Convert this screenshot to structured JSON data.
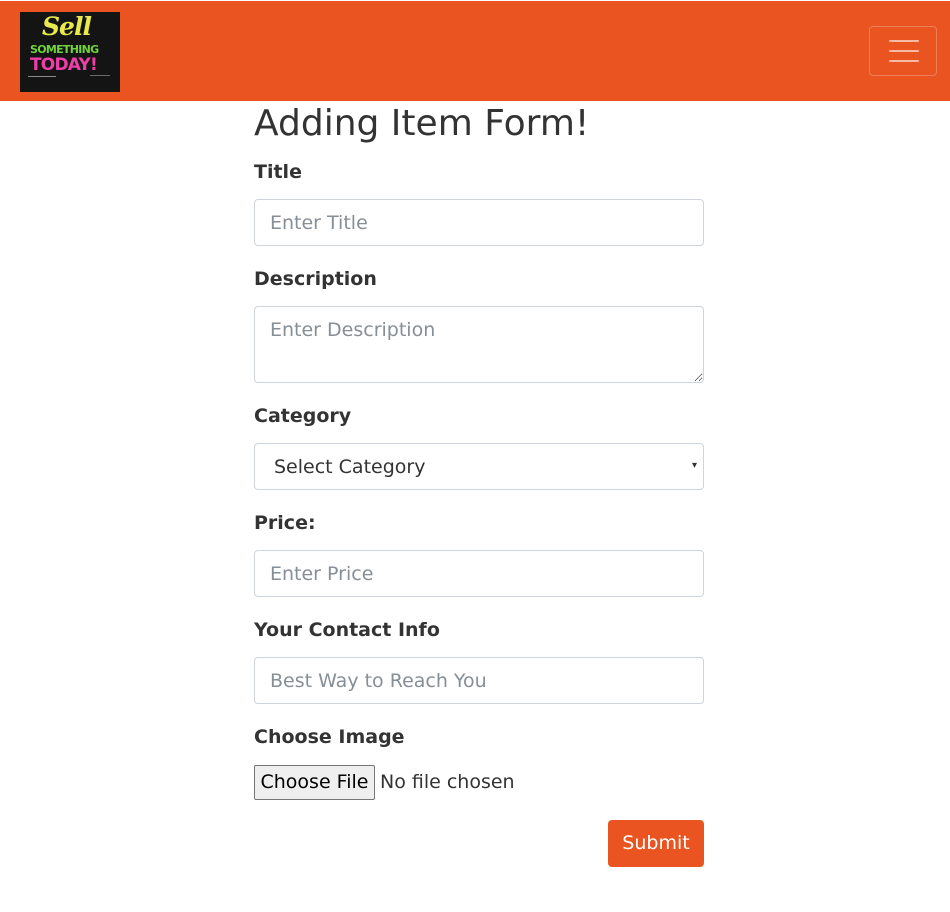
{
  "navbar": {
    "logo": {
      "line1": "Sell",
      "line2": "SOMETHING",
      "line3": "TODAY!"
    },
    "menu_icon": "hamburger-menu-icon"
  },
  "form": {
    "heading": "Adding Item Form!",
    "title": {
      "label": "Title",
      "placeholder": "Enter Title"
    },
    "description": {
      "label": "Description",
      "placeholder": "Enter Description"
    },
    "category": {
      "label": "Category",
      "selected": "Select Category"
    },
    "price": {
      "label": "Price:",
      "placeholder": "Enter Price"
    },
    "contact": {
      "label": "Your Contact Info",
      "placeholder": "Best Way to Reach You"
    },
    "image": {
      "label": "Choose Image",
      "button": "Choose File",
      "status": "No file chosen"
    },
    "submit_label": "Submit"
  },
  "colors": {
    "brand": "#e95420",
    "text": "#333333",
    "border": "#ced4da"
  }
}
